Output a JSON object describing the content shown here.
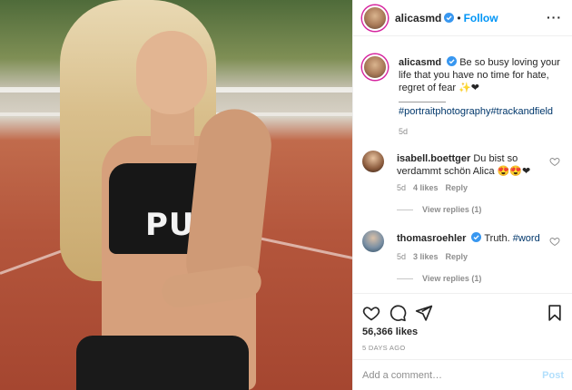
{
  "post": {
    "author": "alicasmd",
    "follow_label": "Follow",
    "separator": "•",
    "more_icon": "more-horizontal-icon"
  },
  "caption": {
    "username": "alicasmd",
    "text": "Be so busy loving your life that you have no time for hate, regret of fear ✨❤",
    "hashtags": "#portraitphotography#trackandfield",
    "time": "5d"
  },
  "comments": [
    {
      "username": "isabell.boettger",
      "text": "Du bist so verdammt schön Alica 😍😍❤",
      "time": "5d",
      "likes": "4 likes",
      "reply_label": "Reply",
      "view_replies": "View replies (1)"
    },
    {
      "username": "thomasroehler",
      "text": "Truth.",
      "tag": "#word",
      "time": "5d",
      "likes": "3 likes",
      "reply_label": "Reply",
      "view_replies": "View replies (1)"
    }
  ],
  "stats": {
    "likes": "56,366 likes",
    "time_ago": "5 DAYS AGO"
  },
  "add_comment": {
    "placeholder": "Add a comment…",
    "post_label": "Post"
  },
  "photo": {
    "shirt_text": "PUMA"
  },
  "colors": {
    "link_blue": "#0095f6",
    "hashtag_blue": "#00376b",
    "muted": "#8e8e8e",
    "post_disabled": "#b2dffc"
  }
}
